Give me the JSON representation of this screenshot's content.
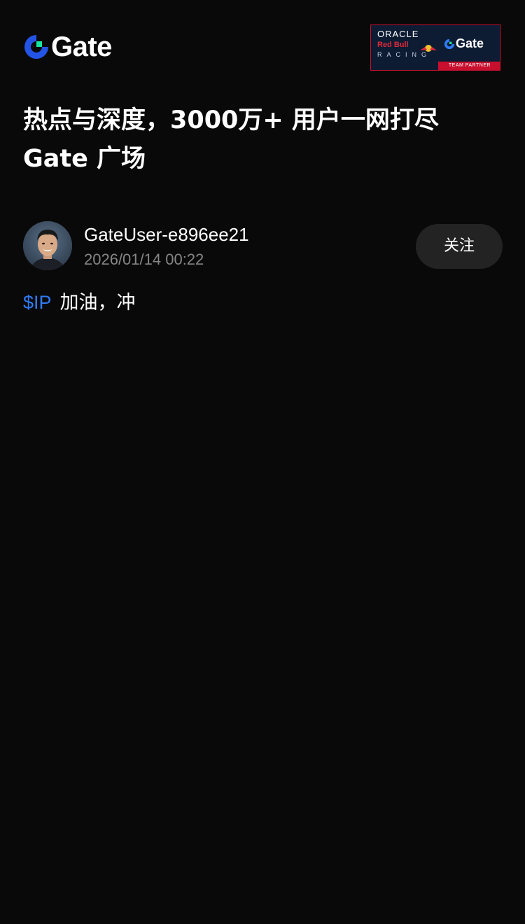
{
  "header": {
    "logo_text": "Gate",
    "brand_colors": {
      "primary_blue": "#2354e6",
      "accent_green": "#17e6a1"
    },
    "partner_banner": {
      "line1": "ORACLE",
      "line2": "Red Bull",
      "line3": "RACING",
      "gate_text": "Gate",
      "footer": "TEAM PARTNER"
    }
  },
  "hero": {
    "title_line1": "热点与深度，3000万+ 用户一网打尽",
    "title_line2": "Gate 广场"
  },
  "post": {
    "author": "GateUser-e896ee21",
    "timestamp": "2026/01/14 00:22",
    "follow_label": "关注",
    "ticker": "$IP",
    "content": "加油，冲",
    "colors": {
      "ticker": "#2f7bf5",
      "follow_bg": "#222322"
    }
  }
}
